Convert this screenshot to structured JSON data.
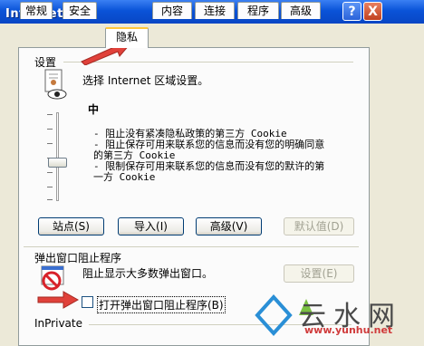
{
  "window": {
    "title": "Internet 属性"
  },
  "titlebar_buttons": {
    "help": "?",
    "close": "X"
  },
  "tabs": [
    {
      "label": "常规"
    },
    {
      "label": "安全"
    },
    {
      "label": "隐私",
      "active": true
    },
    {
      "label": "内容"
    },
    {
      "label": "连接"
    },
    {
      "label": "程序"
    },
    {
      "label": "高级"
    }
  ],
  "settings": {
    "group_label": "设置",
    "instruction": "选择 Internet 区域设置。",
    "level": "中",
    "bullets": [
      "- 阻止没有紧凑隐私政策的第三方 Cookie",
      "- 阻止保存可用来联系您的信息而没有您的明确同意",
      "  的第三方 Cookie",
      "- 限制保存可用来联系您的信息而没有您的默许的第",
      "  一方 Cookie"
    ],
    "slider_level": 0.5,
    "buttons": {
      "sites": "站点(S)",
      "import": "导入(I)",
      "advanced": "高级(V)",
      "default": "默认值(D)"
    }
  },
  "popup": {
    "group_label": "弹出窗口阻止程序",
    "description": "阻止显示大多数弹出窗口。",
    "settings_button": "设置(E)",
    "checkbox_label": "打开弹出窗口阻止程序(B)",
    "checkbox_checked": false
  },
  "inprivate": {
    "group_label": "InPrivate"
  },
  "watermark": {
    "text": "云水网",
    "url": "www.yunhu.net"
  },
  "colors": {
    "accent": "#0a53d8",
    "tab_highlight": "#ffc73c",
    "arrow": "#e0413a"
  }
}
